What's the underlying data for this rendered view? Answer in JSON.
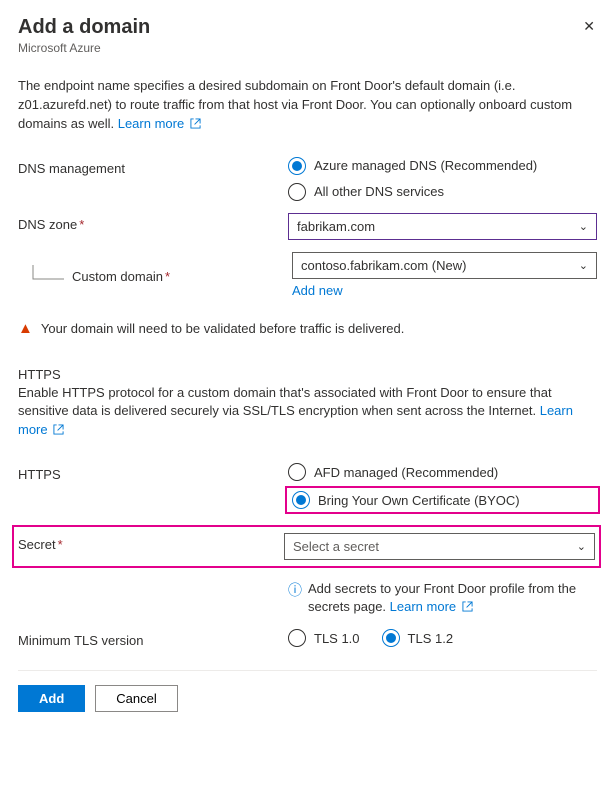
{
  "header": {
    "title": "Add a domain",
    "subtitle": "Microsoft Azure"
  },
  "intro": {
    "text": "The endpoint name specifies a desired subdomain on Front Door's default domain (i.e. z01.azurefd.net) to route traffic from that host via Front Door. You can optionally onboard custom domains as well. ",
    "learn_more": "Learn more"
  },
  "dns_mgmt": {
    "label": "DNS management",
    "option_azure": "Azure managed DNS (Recommended)",
    "option_other": "All other DNS services"
  },
  "dns_zone": {
    "label": "DNS zone",
    "value": "fabrikam.com"
  },
  "custom_domain": {
    "label": "Custom domain",
    "value": "contoso.fabrikam.com (New)",
    "add_new": "Add new"
  },
  "warning": "Your domain will need to be validated before traffic is delivered.",
  "https_section": {
    "header": "HTTPS",
    "desc": "Enable HTTPS protocol for a custom domain that's associated with Front Door to ensure that sensitive data is delivered securely via SSL/TLS encryption when sent across the Internet. ",
    "learn_more": "Learn more"
  },
  "https": {
    "label": "HTTPS",
    "option_afd": "AFD managed (Recommended)",
    "option_byoc": "Bring Your Own Certificate (BYOC)"
  },
  "secret": {
    "label": "Secret",
    "value": "Select a secret",
    "info": "Add secrets to your Front Door profile from the secrets page. ",
    "learn_more": "Learn more"
  },
  "tls": {
    "label": "Minimum TLS version",
    "option_10": "TLS 1.0",
    "option_12": "TLS 1.2"
  },
  "footer": {
    "add": "Add",
    "cancel": "Cancel"
  }
}
